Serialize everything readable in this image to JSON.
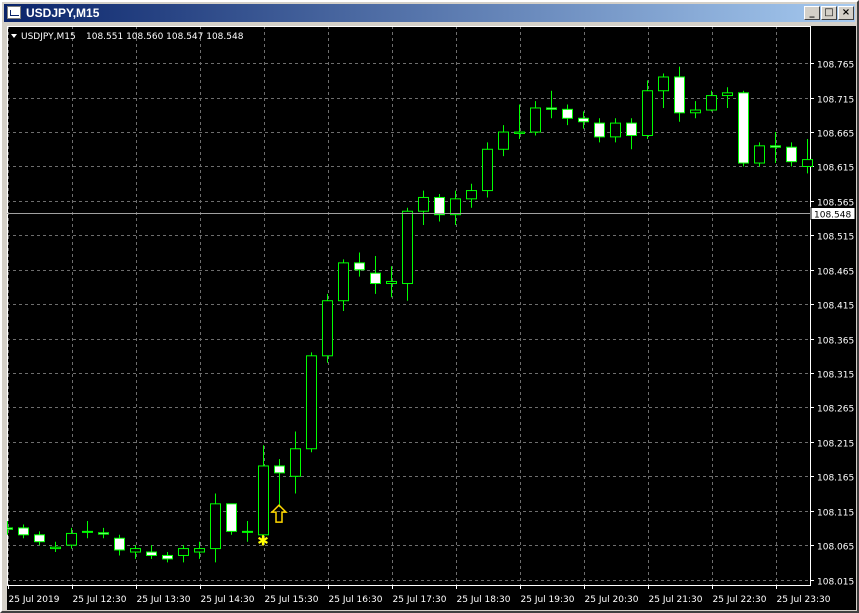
{
  "window": {
    "title": "USDJPY,M15",
    "controls": {
      "minimize": "_",
      "maximize": "□",
      "close": "×"
    }
  },
  "chart_header": {
    "symbol_timeframe": "USDJPY,M15",
    "ohlc": "108.551 108.560 108.547 108.548"
  },
  "current_price": "108.548",
  "colors": {
    "background": "#000000",
    "grid": "#6e6e6e",
    "candle_outline": "#00ff00",
    "bull_body": "#000000",
    "bear_body": "#ffffff",
    "axis_text": "#ffffff",
    "bid_line": "#a0a0a0",
    "arrow": "#ffd700",
    "star": "#ffff00"
  },
  "chart_data": {
    "type": "candlestick",
    "y_labels": [
      "108.765",
      "108.715",
      "108.665",
      "108.615",
      "108.565",
      "108.515",
      "108.465",
      "108.415",
      "108.365",
      "108.315",
      "108.265",
      "108.215",
      "108.165",
      "108.115",
      "108.065",
      "108.015"
    ],
    "ylim": [
      108.01,
      108.79
    ],
    "x_labels": [
      "25 Jul 2019",
      "25 Jul 12:30",
      "25 Jul 13:30",
      "25 Jul 14:30",
      "25 Jul 15:30",
      "25 Jul 16:30",
      "25 Jul 17:30",
      "25 Jul 18:30",
      "25 Jul 19:30",
      "25 Jul 20:30",
      "25 Jul 21:30",
      "25 Jul 22:30",
      "25 Jul 23:30"
    ],
    "grid": true,
    "candles": [
      {
        "o": 108.09,
        "h": 108.1,
        "l": 108.08,
        "c": 108.088
      },
      {
        "o": 108.09,
        "h": 108.095,
        "l": 108.075,
        "c": 108.08
      },
      {
        "o": 108.08,
        "h": 108.085,
        "l": 108.065,
        "c": 108.07
      },
      {
        "o": 108.06,
        "h": 108.07,
        "l": 108.055,
        "c": 108.062
      },
      {
        "o": 108.065,
        "h": 108.09,
        "l": 108.06,
        "c": 108.082
      },
      {
        "o": 108.085,
        "h": 108.1,
        "l": 108.075,
        "c": 108.085
      },
      {
        "o": 108.083,
        "h": 108.09,
        "l": 108.075,
        "c": 108.081
      },
      {
        "o": 108.075,
        "h": 108.08,
        "l": 108.05,
        "c": 108.058
      },
      {
        "o": 108.055,
        "h": 108.065,
        "l": 108.045,
        "c": 108.06
      },
      {
        "o": 108.055,
        "h": 108.065,
        "l": 108.045,
        "c": 108.05
      },
      {
        "o": 108.05,
        "h": 108.055,
        "l": 108.04,
        "c": 108.045
      },
      {
        "o": 108.05,
        "h": 108.065,
        "l": 108.04,
        "c": 108.06
      },
      {
        "o": 108.055,
        "h": 108.07,
        "l": 108.045,
        "c": 108.06
      },
      {
        "o": 108.06,
        "h": 108.14,
        "l": 108.04,
        "c": 108.125
      },
      {
        "o": 108.125,
        "h": 108.125,
        "l": 108.08,
        "c": 108.085
      },
      {
        "o": 108.085,
        "h": 108.1,
        "l": 108.07,
        "c": 108.085
      },
      {
        "o": 108.08,
        "h": 108.21,
        "l": 108.07,
        "c": 108.18
      },
      {
        "o": 108.18,
        "h": 108.19,
        "l": 108.12,
        "c": 108.17
      },
      {
        "o": 108.165,
        "h": 108.23,
        "l": 108.14,
        "c": 108.205
      },
      {
        "o": 108.205,
        "h": 108.345,
        "l": 108.2,
        "c": 108.34
      },
      {
        "o": 108.34,
        "h": 108.43,
        "l": 108.33,
        "c": 108.42
      },
      {
        "o": 108.42,
        "h": 108.48,
        "l": 108.405,
        "c": 108.475
      },
      {
        "o": 108.475,
        "h": 108.49,
        "l": 108.455,
        "c": 108.465
      },
      {
        "o": 108.46,
        "h": 108.485,
        "l": 108.43,
        "c": 108.445
      },
      {
        "o": 108.445,
        "h": 108.47,
        "l": 108.425,
        "c": 108.448
      },
      {
        "o": 108.445,
        "h": 108.555,
        "l": 108.42,
        "c": 108.55
      },
      {
        "o": 108.55,
        "h": 108.58,
        "l": 108.53,
        "c": 108.57
      },
      {
        "o": 108.57,
        "h": 108.575,
        "l": 108.535,
        "c": 108.545
      },
      {
        "o": 108.545,
        "h": 108.58,
        "l": 108.53,
        "c": 108.568
      },
      {
        "o": 108.568,
        "h": 108.59,
        "l": 108.555,
        "c": 108.58
      },
      {
        "o": 108.58,
        "h": 108.65,
        "l": 108.57,
        "c": 108.64
      },
      {
        "o": 108.64,
        "h": 108.675,
        "l": 108.63,
        "c": 108.665
      },
      {
        "o": 108.663,
        "h": 108.705,
        "l": 108.655,
        "c": 108.665
      },
      {
        "o": 108.665,
        "h": 108.71,
        "l": 108.66,
        "c": 108.7
      },
      {
        "o": 108.7,
        "h": 108.725,
        "l": 108.685,
        "c": 108.698
      },
      {
        "o": 108.698,
        "h": 108.705,
        "l": 108.675,
        "c": 108.685
      },
      {
        "o": 108.685,
        "h": 108.695,
        "l": 108.67,
        "c": 108.68
      },
      {
        "o": 108.678,
        "h": 108.685,
        "l": 108.65,
        "c": 108.658
      },
      {
        "o": 108.658,
        "h": 108.685,
        "l": 108.65,
        "c": 108.678
      },
      {
        "o": 108.678,
        "h": 108.685,
        "l": 108.64,
        "c": 108.66
      },
      {
        "o": 108.66,
        "h": 108.74,
        "l": 108.655,
        "c": 108.725
      },
      {
        "o": 108.725,
        "h": 108.75,
        "l": 108.7,
        "c": 108.745
      },
      {
        "o": 108.745,
        "h": 108.76,
        "l": 108.68,
        "c": 108.693
      },
      {
        "o": 108.693,
        "h": 108.71,
        "l": 108.685,
        "c": 108.697
      },
      {
        "o": 108.697,
        "h": 108.725,
        "l": 108.695,
        "c": 108.718
      },
      {
        "o": 108.718,
        "h": 108.73,
        "l": 108.7,
        "c": 108.722
      },
      {
        "o": 108.722,
        "h": 108.725,
        "l": 108.615,
        "c": 108.62
      },
      {
        "o": 108.62,
        "h": 108.65,
        "l": 108.615,
        "c": 108.645
      },
      {
        "o": 108.645,
        "h": 108.665,
        "l": 108.62,
        "c": 108.643
      },
      {
        "o": 108.643,
        "h": 108.65,
        "l": 108.615,
        "c": 108.622
      },
      {
        "o": 108.615,
        "h": 108.655,
        "l": 108.605,
        "c": 108.625
      }
    ],
    "signals": [
      {
        "type": "buy-arrow",
        "candle": 17,
        "price": 108.11
      },
      {
        "type": "star",
        "candle": 16,
        "price": 108.072
      }
    ]
  }
}
